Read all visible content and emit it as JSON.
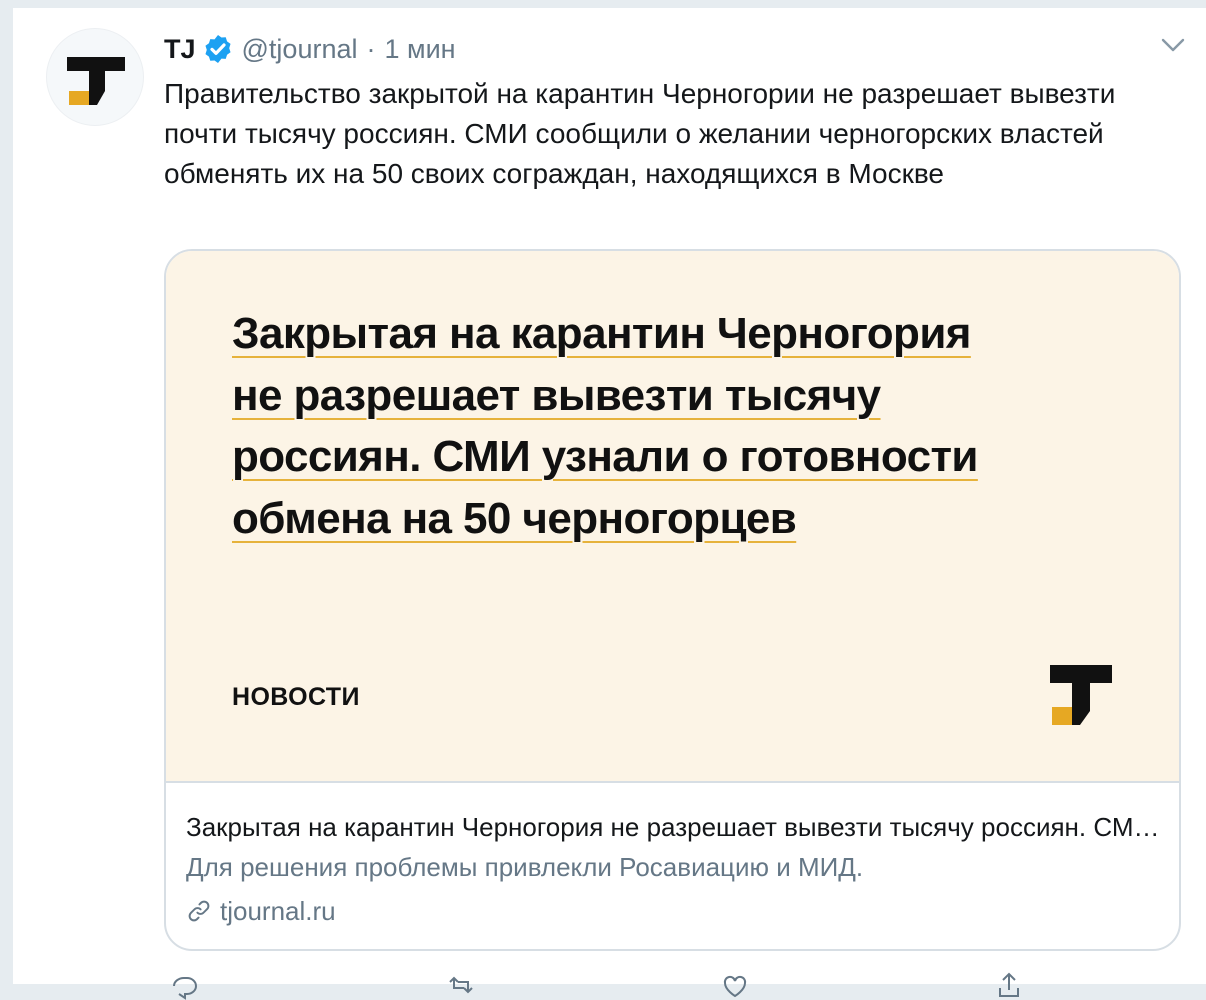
{
  "tweet": {
    "author_name": "TJ",
    "handle": "@tjournal",
    "separator": "·",
    "time": "1 мин",
    "text": "Правительство закрытой на карантин Черногории не разрешает вывезти почти тысячу россиян. СМИ сообщили о желании черногорских властей обменять их на 50 своих сограждан, находящихся в Москве"
  },
  "card": {
    "headline_lines": [
      "Закрытая на карантин Черногория",
      "не разрешает вывезти тысячу",
      "россиян. СМИ узнали о готовности",
      "обмена на 50 черногорцев"
    ],
    "category": "НОВОСТИ",
    "title": "Закрытая на карантин Черногория не разрешает вывезти тысячу россиян. СМИ узнали о готовности обмена на 50 черногорцев",
    "description": "Для решения проблемы привлекли Росавиацию и МИД.",
    "domain": "tjournal.ru"
  },
  "icons": {
    "verified": "verified-badge-icon",
    "caret": "chevron-down-icon",
    "link": "link-icon",
    "logo": "tj-logo"
  },
  "colors": {
    "brand_yellow": "#e6a823",
    "verified_blue": "#1da1f2",
    "card_background": "#fcf4e6",
    "secondary_text": "#657786"
  }
}
